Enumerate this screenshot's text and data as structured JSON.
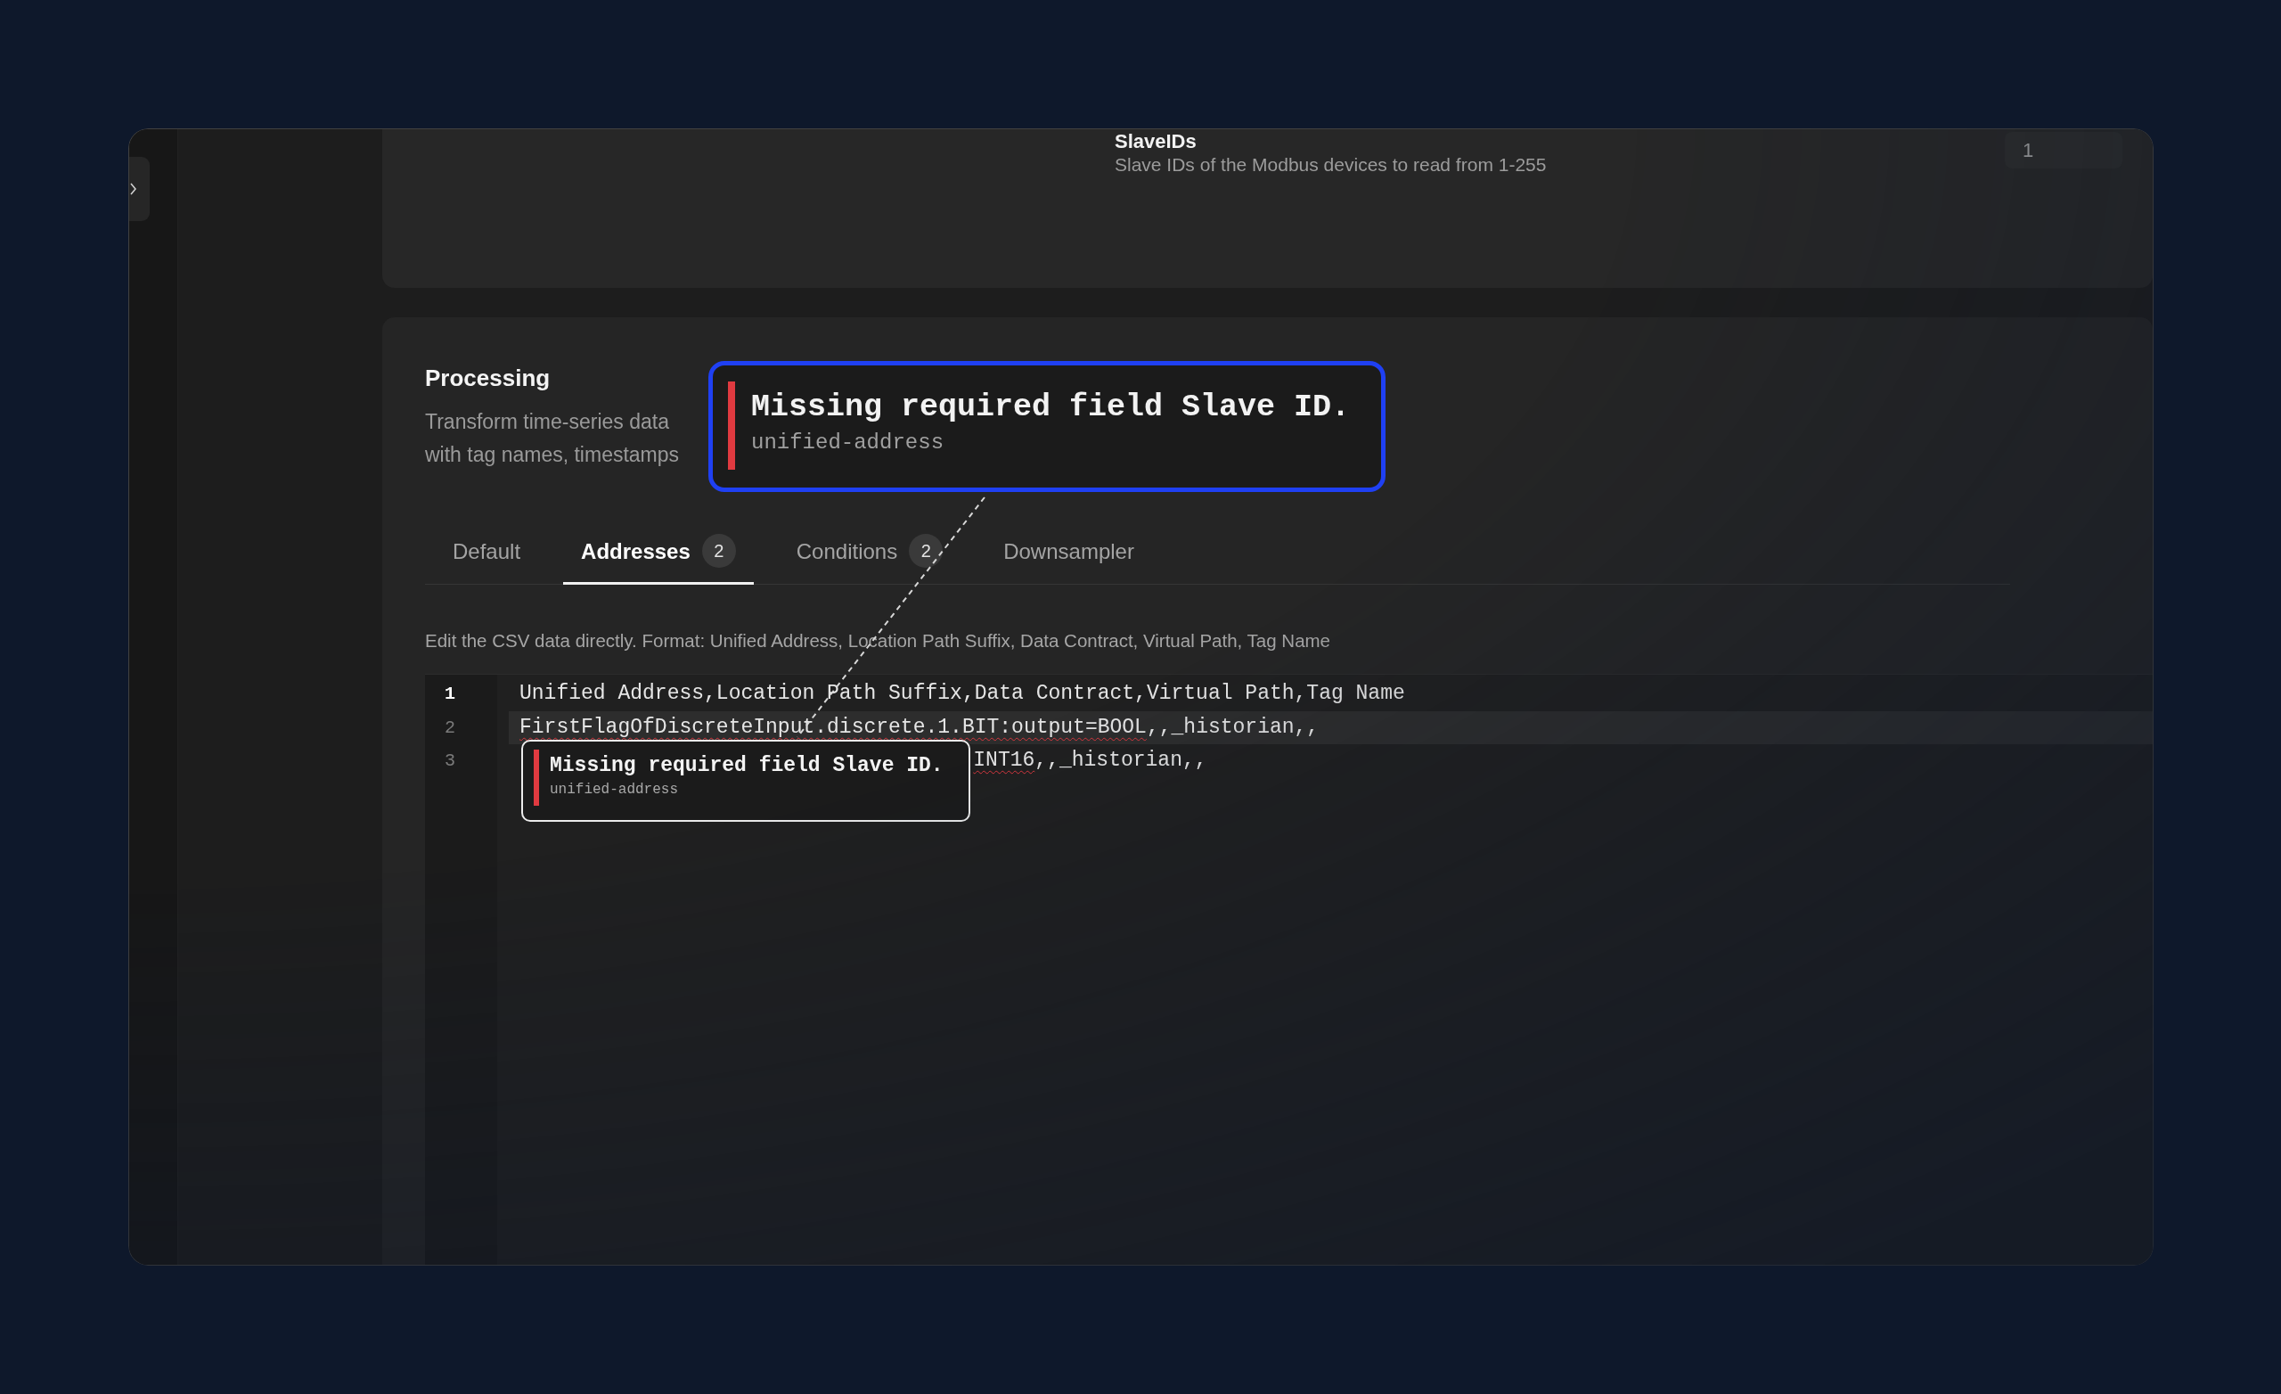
{
  "settings_card": {
    "field": {
      "label": "SlaveIDs",
      "description": "Slave IDs of the Modbus devices to read from 1-255",
      "value": "1"
    }
  },
  "processing": {
    "title": "Processing",
    "description_lines": [
      "Transform time-series data",
      "with tag names, timestamps"
    ],
    "tabs": [
      {
        "label": "Default",
        "selected": false
      },
      {
        "label": "Addresses",
        "badge": "2",
        "selected": true
      },
      {
        "label": "Conditions",
        "badge": "2",
        "selected": false
      },
      {
        "label": "Downsampler",
        "selected": false
      }
    ],
    "hint": "Edit the CSV data directly. Format: Unified Address, Location Path Suffix, Data Contract, Virtual Path, Tag Name",
    "editor": {
      "lines": [
        {
          "number": "1",
          "active": true,
          "highlighted": false,
          "segments": [
            {
              "text": "Unified Address,Location Path Suffix,Data Contract,Virtual Path,Tag Name",
              "error": false
            }
          ]
        },
        {
          "number": "2",
          "active": false,
          "highlighted": true,
          "segments": [
            {
              "text": "FirstFlagOfDiscreteInput.discrete.1.BIT:output=BOOL",
              "error": true
            },
            {
              "text": ",,_historian,,",
              "error": false
            }
          ]
        },
        {
          "number": "3",
          "active": false,
          "highlighted": false,
          "segments": [
            {
              "text": "INT16",
              "error": true
            },
            {
              "text": ",,_historian,,",
              "error": false
            }
          ]
        }
      ],
      "tooltip": {
        "message": "Missing required field Slave ID.",
        "source": "unified-address"
      }
    }
  },
  "zoom_callout": {
    "message": "Missing required field Slave ID.",
    "source": "unified-address"
  }
}
